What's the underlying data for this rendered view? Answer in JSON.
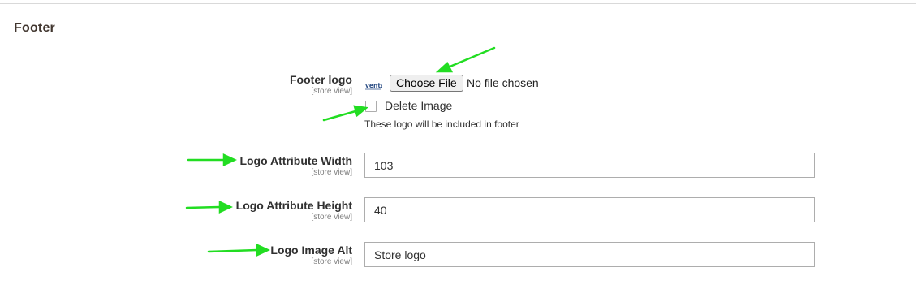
{
  "section": {
    "title": "Footer"
  },
  "scope_label": "[store view]",
  "footer_logo": {
    "label": "Footer logo",
    "thumbnail_text": "venta",
    "choose_file_label": "Choose File",
    "file_status": "No file chosen",
    "delete_label": "Delete Image",
    "delete_checked": false,
    "note": "These logo will be included in footer"
  },
  "logo_width": {
    "label": "Logo Attribute Width",
    "value": "103"
  },
  "logo_height": {
    "label": "Logo Attribute Height",
    "value": "40"
  },
  "logo_alt": {
    "label": "Logo Image Alt",
    "value": "Store logo"
  },
  "annotation": {
    "arrow_color": "#22dd22"
  }
}
